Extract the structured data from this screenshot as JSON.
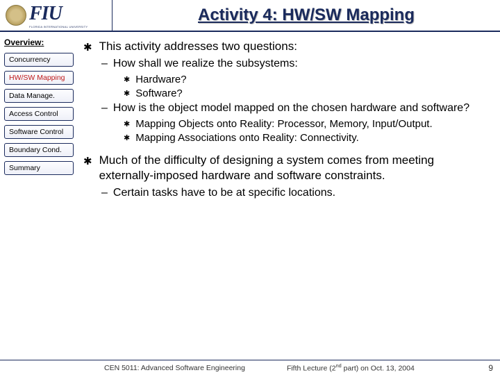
{
  "header": {
    "logo_text": "FIU",
    "logo_sub": "FLORIDA INTERNATIONAL UNIVERSITY",
    "title": "Activity 4: HW/SW Mapping"
  },
  "sidebar": {
    "heading": "Overview:",
    "items": [
      {
        "label": "Concurrency",
        "active": false
      },
      {
        "label": "HW/SW Mapping",
        "active": true
      },
      {
        "label": "Data Manage.",
        "active": false
      },
      {
        "label": "Access Control",
        "active": false
      },
      {
        "label": "Software Control",
        "active": false
      },
      {
        "label": "Boundary Cond.",
        "active": false
      },
      {
        "label": "Summary",
        "active": false
      }
    ]
  },
  "content": {
    "b1": "This activity addresses two questions:",
    "b1_d1": "How shall we realize the subsystems:",
    "b1_d1_s1": "Hardware?",
    "b1_d1_s2": "Software?",
    "b1_d2": "How is the object model mapped on the chosen hardware and software?",
    "b1_d2_s1": "Mapping Objects onto Reality: Processor, Memory, Input/Output.",
    "b1_d2_s2": "Mapping Associations onto Reality: Connectivity.",
    "b2": "Much of the difficulty of designing a system comes from meeting externally-imposed hardware and software constraints.",
    "b2_d1": "Certain tasks have to be at specific locations."
  },
  "footer": {
    "course": "CEN 5011: Advanced Software Engineering",
    "lecture_pre": "Fifth Lecture (2",
    "lecture_sup": "nd",
    "lecture_post": " part) on Oct. 13, 2004",
    "page": "9"
  }
}
